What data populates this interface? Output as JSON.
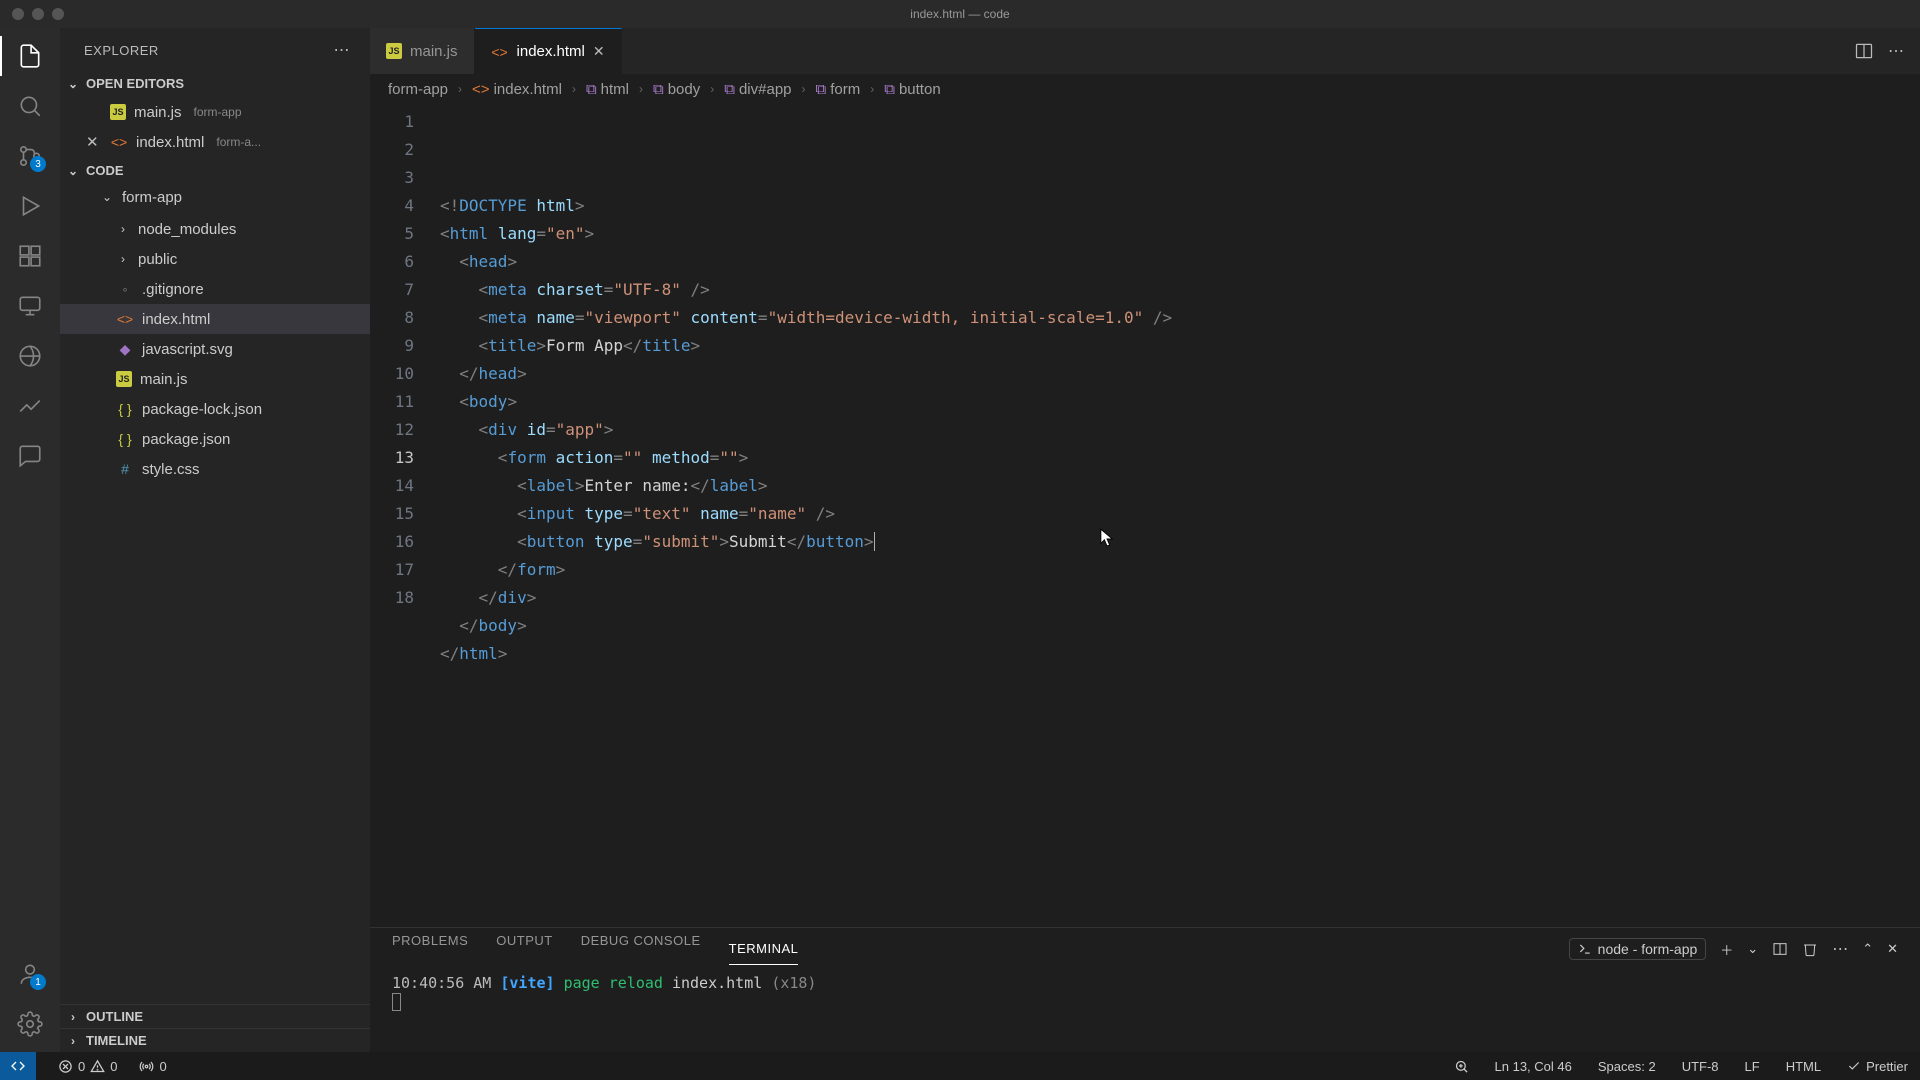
{
  "window": {
    "title": "index.html — code"
  },
  "activity": {
    "badges": {
      "scm": "3",
      "account": "1"
    }
  },
  "sidebar": {
    "title": "EXPLORER",
    "sections": {
      "open_editors": "OPEN EDITORS",
      "workspace": "CODE",
      "outline": "OUTLINE",
      "timeline": "TIMELINE"
    },
    "open_editors": [
      {
        "name": "main.js",
        "dir": "form-app",
        "icon": "js",
        "closable": false
      },
      {
        "name": "index.html",
        "dir": "form-a...",
        "icon": "html",
        "closable": true
      }
    ],
    "tree": {
      "root": "form-app",
      "items": [
        {
          "name": "node_modules",
          "kind": "folder"
        },
        {
          "name": "public",
          "kind": "folder"
        },
        {
          "name": ".gitignore",
          "kind": "file",
          "icon": "git"
        },
        {
          "name": "index.html",
          "kind": "file",
          "icon": "html",
          "selected": true
        },
        {
          "name": "javascript.svg",
          "kind": "file",
          "icon": "svg"
        },
        {
          "name": "main.js",
          "kind": "file",
          "icon": "js"
        },
        {
          "name": "package-lock.json",
          "kind": "file",
          "icon": "json"
        },
        {
          "name": "package.json",
          "kind": "file",
          "icon": "json"
        },
        {
          "name": "style.css",
          "kind": "file",
          "icon": "css"
        }
      ]
    }
  },
  "tabs": [
    {
      "label": "main.js",
      "icon": "js",
      "active": false
    },
    {
      "label": "index.html",
      "icon": "html",
      "active": true
    }
  ],
  "breadcrumbs": [
    {
      "label": "form-app",
      "kind": "folder"
    },
    {
      "label": "index.html",
      "kind": "html"
    },
    {
      "label": "html",
      "kind": "sym"
    },
    {
      "label": "body",
      "kind": "sym"
    },
    {
      "label": "div#app",
      "kind": "sym"
    },
    {
      "label": "form",
      "kind": "sym"
    },
    {
      "label": "button",
      "kind": "sym"
    }
  ],
  "editor": {
    "current_line": 13,
    "lines": [
      {
        "n": 1,
        "html": "<span class='p'>&lt;!</span><span class='d'>DOCTYPE</span> <span class='a'>html</span><span class='p'>&gt;</span>"
      },
      {
        "n": 2,
        "html": "<span class='p'>&lt;</span><span class='t'>html</span> <span class='a'>lang</span><span class='p'>=</span><span class='s'>\"en\"</span><span class='p'>&gt;</span>"
      },
      {
        "n": 3,
        "html": "  <span class='p'>&lt;</span><span class='t'>head</span><span class='p'>&gt;</span>"
      },
      {
        "n": 4,
        "html": "    <span class='p'>&lt;</span><span class='t'>meta</span> <span class='a'>charset</span><span class='p'>=</span><span class='s'>\"UTF-8\"</span> <span class='p'>/&gt;</span>"
      },
      {
        "n": 5,
        "html": "    <span class='p'>&lt;</span><span class='t'>meta</span> <span class='a'>name</span><span class='p'>=</span><span class='s'>\"viewport\"</span> <span class='a'>content</span><span class='p'>=</span><span class='s'>\"width=device-width, initial-scale=1.0\"</span> <span class='p'>/&gt;</span>"
      },
      {
        "n": 6,
        "html": "    <span class='p'>&lt;</span><span class='t'>title</span><span class='p'>&gt;</span><span class='tx'>Form App</span><span class='p'>&lt;/</span><span class='t'>title</span><span class='p'>&gt;</span>"
      },
      {
        "n": 7,
        "html": "  <span class='p'>&lt;/</span><span class='t'>head</span><span class='p'>&gt;</span>"
      },
      {
        "n": 8,
        "html": "  <span class='p'>&lt;</span><span class='t'>body</span><span class='p'>&gt;</span>"
      },
      {
        "n": 9,
        "html": "    <span class='p'>&lt;</span><span class='t'>div</span> <span class='a'>id</span><span class='p'>=</span><span class='s'>\"app\"</span><span class='p'>&gt;</span>"
      },
      {
        "n": 10,
        "html": "      <span class='p'>&lt;</span><span class='t'>form</span> <span class='a'>action</span><span class='p'>=</span><span class='s'>\"\"</span> <span class='a'>method</span><span class='p'>=</span><span class='s'>\"\"</span><span class='p'>&gt;</span>"
      },
      {
        "n": 11,
        "html": "        <span class='p'>&lt;</span><span class='t'>label</span><span class='p'>&gt;</span><span class='tx'>Enter name:</span><span class='p'>&lt;/</span><span class='t'>label</span><span class='p'>&gt;</span>"
      },
      {
        "n": 12,
        "html": "        <span class='p'>&lt;</span><span class='t'>input</span> <span class='a'>type</span><span class='p'>=</span><span class='s'>\"text\"</span> <span class='a'>name</span><span class='p'>=</span><span class='s'>\"name\"</span> <span class='p'>/&gt;</span>"
      },
      {
        "n": 13,
        "html": "        <span class='p'>&lt;</span><span class='t'>button</span> <span class='a'>type</span><span class='p'>=</span><span class='s'>\"submit\"</span><span class='p'>&gt;</span><span class='tx'>Submit</span><span class='p'>&lt;/</span><span class='t'>button</span><span class='p'>&gt;</span><span class='cursor'></span>"
      },
      {
        "n": 14,
        "html": "      <span class='p'>&lt;/</span><span class='t'>form</span><span class='p'>&gt;</span>"
      },
      {
        "n": 15,
        "html": "    <span class='p'>&lt;/</span><span class='t'>div</span><span class='p'>&gt;</span>"
      },
      {
        "n": 16,
        "html": "  <span class='p'>&lt;/</span><span class='t'>body</span><span class='p'>&gt;</span>"
      },
      {
        "n": 17,
        "html": "<span class='p'>&lt;/</span><span class='t'>html</span><span class='p'>&gt;</span>"
      },
      {
        "n": 18,
        "html": ""
      }
    ]
  },
  "panel": {
    "tabs": [
      "PROBLEMS",
      "OUTPUT",
      "DEBUG CONSOLE",
      "TERMINAL"
    ],
    "active_tab": "TERMINAL",
    "process": "node - form-app",
    "line": {
      "time": "10:40:56 AM",
      "tag": "[vite]",
      "action": "page reload",
      "file": "index.html",
      "count": "(x18)"
    }
  },
  "status": {
    "errors": "0",
    "warnings": "0",
    "ports": "0",
    "position": "Ln 13, Col 46",
    "spaces": "Spaces: 2",
    "encoding": "UTF-8",
    "eol": "LF",
    "lang": "HTML",
    "formatter": "Prettier"
  }
}
